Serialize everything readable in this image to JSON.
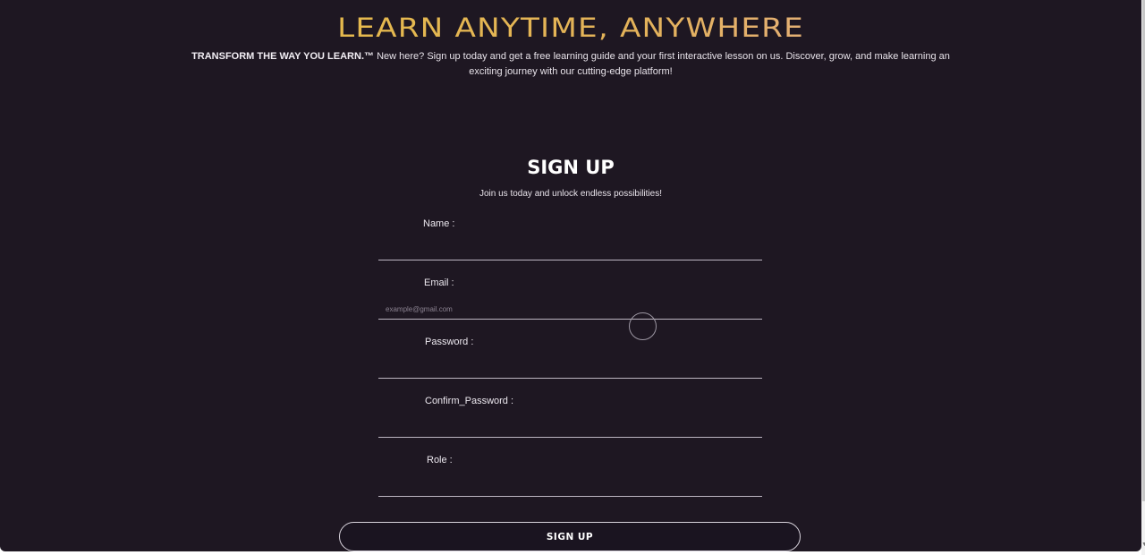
{
  "hero": {
    "title": "LEARN ANYTIME, ANYWHERE",
    "tagline": "TRANSFORM THE WAY YOU LEARN.™",
    "description": " New here? Sign up today and get a free learning guide and your first interactive lesson on us. Discover, grow, and make learning an exciting journey with our cutting-edge platform!"
  },
  "form": {
    "heading": "SIGN UP",
    "subheading": "Join us today and unlock endless possibilities!",
    "fields": {
      "name": {
        "label": "Name :",
        "value": "",
        "placeholder": ""
      },
      "email": {
        "label": "Email :",
        "value": "",
        "placeholder": "example@gmail.com"
      },
      "password": {
        "label": "Password :",
        "value": "",
        "placeholder": ""
      },
      "confirm_password": {
        "label": "Confirm_Password :",
        "value": "",
        "placeholder": ""
      },
      "role": {
        "label": "Role :",
        "value": "",
        "placeholder": ""
      }
    },
    "submit_label": "SIGN UP"
  },
  "colors": {
    "background": "#1e1722",
    "title_gradient_start": "#e8c43a",
    "title_gradient_end": "#e7a9b8",
    "text": "#e8e3ea",
    "input_underline": "#bdb6c2"
  }
}
